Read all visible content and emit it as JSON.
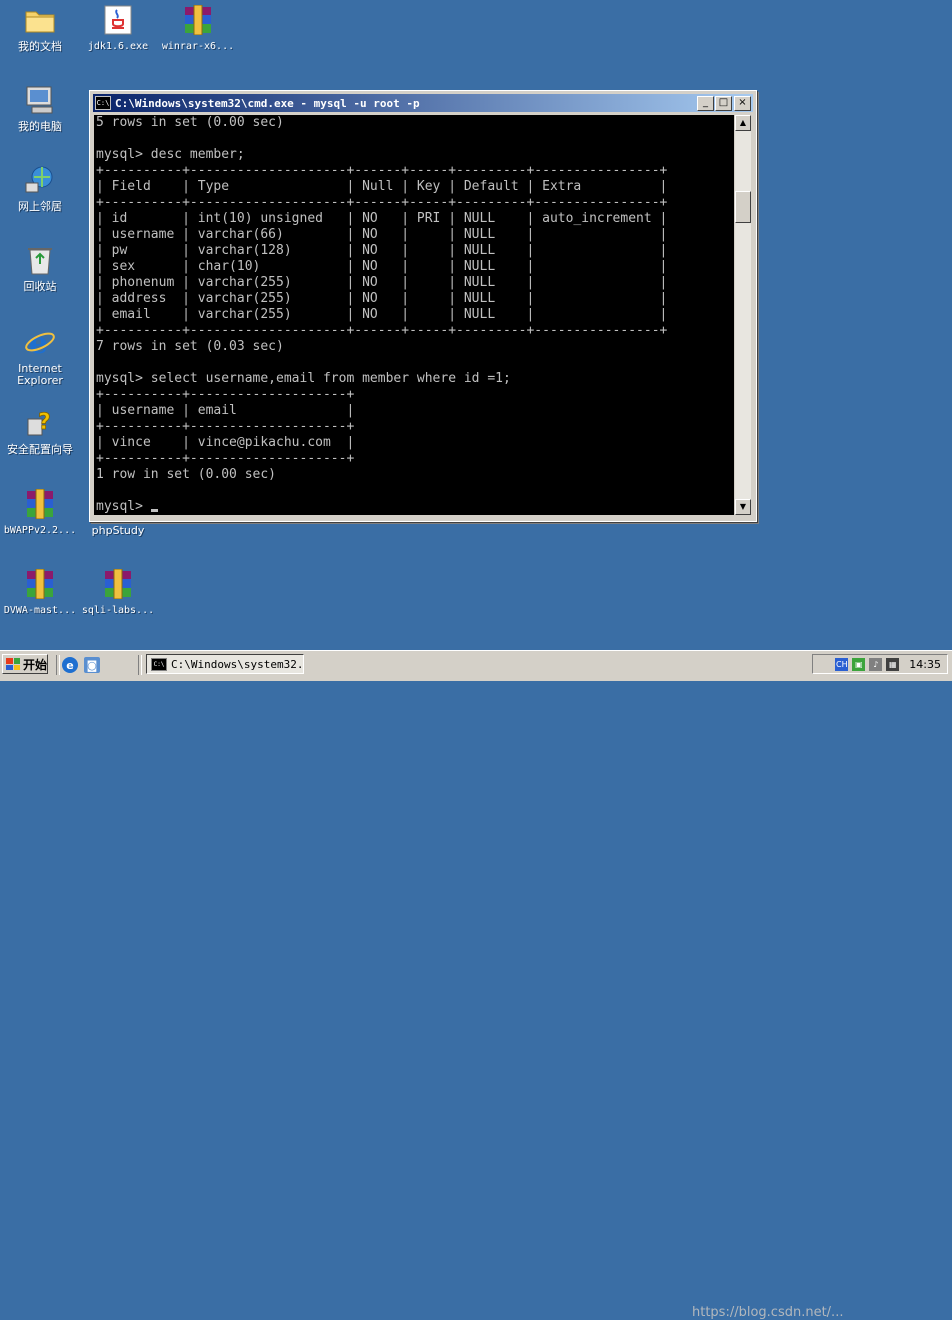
{
  "desktop": {
    "icons": [
      {
        "label": "我的文档",
        "icon": "folder-icon"
      },
      {
        "label": "jdk1.6.exe",
        "icon": "java-icon"
      },
      {
        "label": "winrar-x6...",
        "icon": "winrar-icon"
      },
      {
        "label": "我的电脑",
        "icon": "computer-icon"
      },
      {
        "label": "网上邻居",
        "icon": "network-icon"
      },
      {
        "label": "回收站",
        "icon": "recycle-bin-icon"
      },
      {
        "label": "Internet Explorer",
        "icon": "ie-icon"
      },
      {
        "label": "安全配置向导",
        "icon": "security-wizard-icon"
      },
      {
        "label": "bWAPPv2.2...",
        "icon": "winrar-icon"
      },
      {
        "label": "phpStudy",
        "icon": "winrar-icon"
      },
      {
        "label": "DVWA-mast...",
        "icon": "winrar-icon"
      },
      {
        "label": "sqli-labs...",
        "icon": "winrar-icon"
      }
    ]
  },
  "window": {
    "title": "C:\\Windows\\system32\\cmd.exe - mysql -u root -p",
    "icon_text": "C:\\",
    "minimize": "_",
    "maximize": "□",
    "close": "×",
    "console_text": "5 rows in set (0.00 sec)\n\nmysql> desc member;\n+----------+--------------------+------+-----+---------+----------------+\n| Field    | Type               | Null | Key | Default | Extra          |\n+----------+--------------------+------+-----+---------+----------------+\n| id       | int(10) unsigned   | NO   | PRI | NULL    | auto_increment |\n| username | varchar(66)        | NO   |     | NULL    |                |\n| pw       | varchar(128)       | NO   |     | NULL    |                |\n| sex      | char(10)           | NO   |     | NULL    |                |\n| phonenum | varchar(255)       | NO   |     | NULL    |                |\n| address  | varchar(255)       | NO   |     | NULL    |                |\n| email    | varchar(255)       | NO   |     | NULL    |                |\n+----------+--------------------+------+-----+---------+----------------+\n7 rows in set (0.03 sec)\n\nmysql> select username,email from member where id =1;\n+----------+--------------------+\n| username | email              |\n+----------+--------------------+\n| vince    | vince@pikachu.com  |\n+----------+--------------------+\n1 row in set (0.00 sec)\n\n",
    "prompt": "mysql> ",
    "scroll_up": "▲",
    "scroll_down": "▼"
  },
  "taskbar": {
    "start_label": "开始",
    "task_label": "C:\\Windows\\system32...",
    "clock": "14:35",
    "tray_icons": [
      "ime-icon",
      "network-tray-icon",
      "volume-tray-icon",
      "tray-app-icon"
    ]
  },
  "watermark": "https://blog.csdn.net/..."
}
